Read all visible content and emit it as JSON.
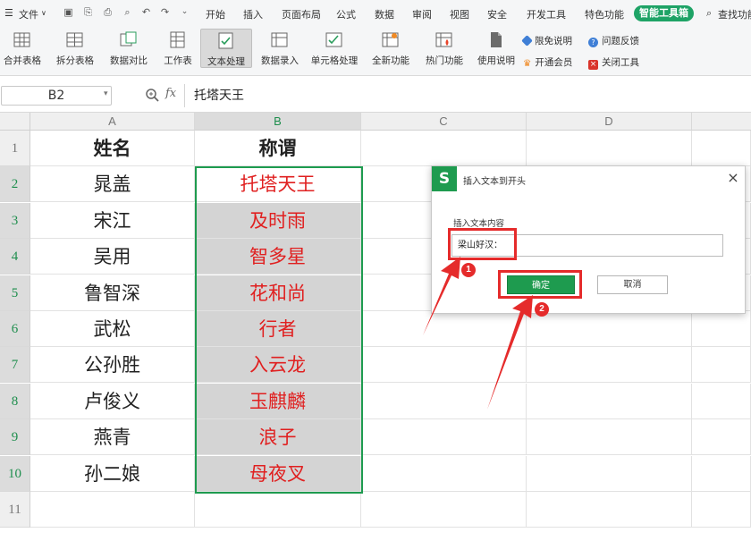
{
  "menubar": {
    "file_label": "文件",
    "tabs": [
      "开始",
      "插入",
      "页面布局",
      "公式",
      "数据",
      "审阅",
      "视图",
      "安全",
      "开发工具",
      "特色功能"
    ],
    "smart_tab": "智能工具箱",
    "search_label": "查找功能"
  },
  "ribbon": {
    "buttons": [
      "合并表格",
      "拆分表格",
      "数据对比",
      "工作表",
      "文本处理",
      "数据录入",
      "单元格处理",
      "全新功能",
      "热门功能",
      "使用说明"
    ],
    "small": {
      "limit_free": "限免说明",
      "open_member": "开通会员",
      "feedback": "问题反馈",
      "close_tool": "关闭工具"
    }
  },
  "formula_bar": {
    "cell_ref": "B2",
    "fx": "fx",
    "value": "托塔天王"
  },
  "sheet": {
    "columns": [
      "A",
      "B",
      "C",
      "D"
    ],
    "rows": [
      "1",
      "2",
      "3",
      "4",
      "5",
      "6",
      "7",
      "8",
      "9",
      "10",
      "11"
    ],
    "col_a": [
      "姓名",
      "晁盖",
      "宋江",
      "吴用",
      "鲁智深",
      "武松",
      "公孙胜",
      "卢俊义",
      "燕青",
      "孙二娘"
    ],
    "col_b": [
      "称谓",
      "托塔天王",
      "及时雨",
      "智多星",
      "花和尚",
      "行者",
      "入云龙",
      "玉麒麟",
      "浪子",
      "母夜叉"
    ]
  },
  "dialog": {
    "logo": "S",
    "title": "插入文本到开头",
    "close": "×",
    "label": "插入文本内容",
    "input_value": "梁山好汉：",
    "ok": "确定",
    "cancel": "取消"
  },
  "annotations": {
    "badge1": "1",
    "badge2": "2",
    "color": "#e52b2b"
  },
  "colors": {
    "accent_green": "#1e9b4f",
    "text_red": "#e02020",
    "selection_shade": "#d4d4d4"
  }
}
